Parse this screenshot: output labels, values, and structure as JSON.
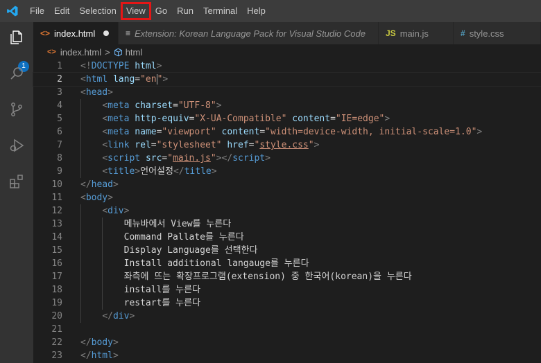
{
  "menubar": {
    "items": [
      "File",
      "Edit",
      "Selection",
      "View",
      "Go",
      "Run",
      "Terminal",
      "Help"
    ],
    "highlighted": "View"
  },
  "activity": {
    "badge": "1"
  },
  "tabs": [
    {
      "label": "index.html",
      "icon": "html-icon",
      "modified": true,
      "active": true,
      "italic": false
    },
    {
      "label": "Extension: Korean Language Pack for Visual Studio Code",
      "icon": "extension-doc-icon",
      "modified": false,
      "active": false,
      "italic": true
    },
    {
      "label": "main.js",
      "icon": "js-icon",
      "modified": false,
      "active": false,
      "italic": false
    },
    {
      "label": "style.css",
      "icon": "css-icon",
      "modified": false,
      "active": false,
      "italic": false
    }
  ],
  "tab_icons": {
    "html": "<>",
    "ext": "≡",
    "js": "JS",
    "css": "#"
  },
  "breadcrumb": {
    "file": "index.html",
    "element": "html",
    "sep": ">"
  },
  "editor": {
    "current_line": 2,
    "lines": [
      {
        "n": "1",
        "s": [
          [
            "t",
            "<!"
          ],
          [
            "tn",
            "DOCTYPE"
          ],
          [
            "tx",
            " "
          ],
          [
            "an",
            "html"
          ],
          [
            "t",
            ">"
          ]
        ]
      },
      {
        "n": "2",
        "s": [
          [
            "t",
            "<"
          ],
          [
            "tn",
            "html"
          ],
          [
            "tx",
            " "
          ],
          [
            "an",
            "lang"
          ],
          [
            "tx",
            "="
          ],
          [
            "av",
            "\"en"
          ],
          [
            "cursor",
            ""
          ],
          [
            "av",
            "\""
          ],
          [
            "t",
            ">"
          ]
        ]
      },
      {
        "n": "3",
        "s": [
          [
            "t",
            "<"
          ],
          [
            "tn",
            "head"
          ],
          [
            "t",
            ">"
          ]
        ]
      },
      {
        "n": "4",
        "s": [
          [
            "tx",
            "    "
          ],
          [
            "t",
            "<"
          ],
          [
            "tn",
            "meta"
          ],
          [
            "tx",
            " "
          ],
          [
            "an",
            "charset"
          ],
          [
            "tx",
            "="
          ],
          [
            "av",
            "\"UTF-8\""
          ],
          [
            "t",
            ">"
          ]
        ]
      },
      {
        "n": "5",
        "s": [
          [
            "tx",
            "    "
          ],
          [
            "t",
            "<"
          ],
          [
            "tn",
            "meta"
          ],
          [
            "tx",
            " "
          ],
          [
            "an",
            "http-equiv"
          ],
          [
            "tx",
            "="
          ],
          [
            "av",
            "\"X-UA-Compatible\""
          ],
          [
            "tx",
            " "
          ],
          [
            "an",
            "content"
          ],
          [
            "tx",
            "="
          ],
          [
            "av",
            "\"IE=edge\""
          ],
          [
            "t",
            ">"
          ]
        ]
      },
      {
        "n": "6",
        "s": [
          [
            "tx",
            "    "
          ],
          [
            "t",
            "<"
          ],
          [
            "tn",
            "meta"
          ],
          [
            "tx",
            " "
          ],
          [
            "an",
            "name"
          ],
          [
            "tx",
            "="
          ],
          [
            "av",
            "\"viewport\""
          ],
          [
            "tx",
            " "
          ],
          [
            "an",
            "content"
          ],
          [
            "tx",
            "="
          ],
          [
            "av",
            "\"width=device-width, initial-scale=1.0\""
          ],
          [
            "t",
            ">"
          ]
        ]
      },
      {
        "n": "7",
        "s": [
          [
            "tx",
            "    "
          ],
          [
            "t",
            "<"
          ],
          [
            "tn",
            "link"
          ],
          [
            "tx",
            " "
          ],
          [
            "an",
            "rel"
          ],
          [
            "tx",
            "="
          ],
          [
            "av",
            "\"stylesheet\""
          ],
          [
            "tx",
            " "
          ],
          [
            "an",
            "href"
          ],
          [
            "tx",
            "="
          ],
          [
            "av",
            "\""
          ],
          [
            "avu",
            "style.css"
          ],
          [
            "av",
            "\""
          ],
          [
            "t",
            ">"
          ]
        ]
      },
      {
        "n": "8",
        "s": [
          [
            "tx",
            "    "
          ],
          [
            "t",
            "<"
          ],
          [
            "tn",
            "script"
          ],
          [
            "tx",
            " "
          ],
          [
            "an",
            "src"
          ],
          [
            "tx",
            "="
          ],
          [
            "av",
            "\""
          ],
          [
            "avu",
            "main.js"
          ],
          [
            "av",
            "\""
          ],
          [
            "t",
            "></"
          ],
          [
            "tn",
            "script"
          ],
          [
            "t",
            ">"
          ]
        ]
      },
      {
        "n": "9",
        "s": [
          [
            "tx",
            "    "
          ],
          [
            "t",
            "<"
          ],
          [
            "tn",
            "title"
          ],
          [
            "t",
            ">"
          ],
          [
            "tx",
            "언어설정"
          ],
          [
            "t",
            "</"
          ],
          [
            "tn",
            "title"
          ],
          [
            "t",
            ">"
          ]
        ]
      },
      {
        "n": "10",
        "s": [
          [
            "t",
            "</"
          ],
          [
            "tn",
            "head"
          ],
          [
            "t",
            ">"
          ]
        ]
      },
      {
        "n": "11",
        "s": [
          [
            "t",
            "<"
          ],
          [
            "tn",
            "body"
          ],
          [
            "t",
            ">"
          ]
        ]
      },
      {
        "n": "12",
        "s": [
          [
            "tx",
            "    "
          ],
          [
            "t",
            "<"
          ],
          [
            "tn",
            "div"
          ],
          [
            "t",
            ">"
          ]
        ]
      },
      {
        "n": "13",
        "s": [
          [
            "tx",
            "        메뉴바에서 View를 누른다"
          ]
        ]
      },
      {
        "n": "14",
        "s": [
          [
            "tx",
            "        Command Pallate를 누른다"
          ]
        ]
      },
      {
        "n": "15",
        "s": [
          [
            "tx",
            "        Display Language를 선택한다"
          ]
        ]
      },
      {
        "n": "16",
        "s": [
          [
            "tx",
            "        Install additional langauge를 누른다"
          ]
        ]
      },
      {
        "n": "17",
        "s": [
          [
            "tx",
            "        좌측에 뜨는 확장프로그램(extension) 중 한국어(korean)을 누른다"
          ]
        ]
      },
      {
        "n": "18",
        "s": [
          [
            "tx",
            "        install를 누른다"
          ]
        ]
      },
      {
        "n": "19",
        "s": [
          [
            "tx",
            "        restart를 누른다"
          ]
        ]
      },
      {
        "n": "20",
        "s": [
          [
            "tx",
            "    "
          ],
          [
            "t",
            "</"
          ],
          [
            "tn",
            "div"
          ],
          [
            "t",
            ">"
          ]
        ]
      },
      {
        "n": "21",
        "s": []
      },
      {
        "n": "22",
        "s": [
          [
            "t",
            "</"
          ],
          [
            "tn",
            "body"
          ],
          [
            "t",
            ">"
          ]
        ]
      },
      {
        "n": "23",
        "s": [
          [
            "t",
            "</"
          ],
          [
            "tn",
            "html"
          ],
          [
            "t",
            ">"
          ]
        ]
      }
    ]
  }
}
